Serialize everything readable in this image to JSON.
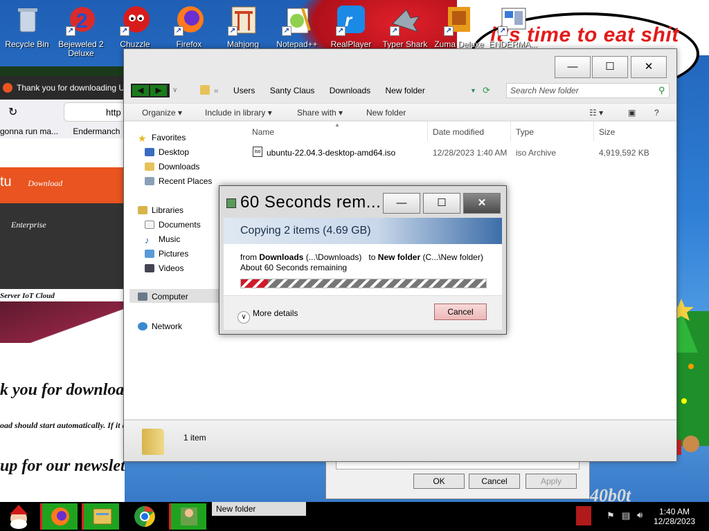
{
  "wallpaper": {
    "speech_text": "it's time to eat shit",
    "bottom_text": "40b0t"
  },
  "desktop_icons": [
    {
      "label": "Recycle Bin",
      "icon": "recycle-bin-icon",
      "shortcut": false
    },
    {
      "label": "Bejeweled 2 Deluxe",
      "icon": "bejeweled-icon",
      "shortcut": true
    },
    {
      "label": "Chuzzle",
      "icon": "chuzzle-icon",
      "shortcut": true
    },
    {
      "label": "Firefox",
      "icon": "firefox-icon",
      "shortcut": true
    },
    {
      "label": "Mahjong",
      "icon": "mahjong-icon",
      "shortcut": true
    },
    {
      "label": "Notepad++",
      "icon": "notepad-plus-icon",
      "shortcut": true
    },
    {
      "label": "RealPlayer",
      "icon": "realplayer-icon",
      "shortcut": true
    },
    {
      "label": "Typer Shark",
      "icon": "typer-shark-icon",
      "shortcut": true
    },
    {
      "label": "Zuma Deluxe",
      "icon": "zuma-icon",
      "shortcut": true
    },
    {
      "label": "ENDERMA...",
      "icon": "enderman-icon",
      "shortcut": true
    }
  ],
  "browser": {
    "tab_title": "Thank you for downloading U",
    "url": "http",
    "bookmark1": "gonna run ma...",
    "bookmark2": "Endermanch",
    "logo_text": "tu",
    "nav_download": "Download",
    "nav_enterprise": "Enterprise",
    "nav_items": "Server    IoT    Cloud",
    "heading1": "k you for downloading",
    "heading2": "oad should start automatically. If it doesn",
    "heading3": "up for our newsletter"
  },
  "properties_dialog": {
    "ok": "OK",
    "cancel": "Cancel",
    "apply": "Apply"
  },
  "explorer": {
    "breadcrumbs": [
      "Users",
      "Santy Claus",
      "Downloads",
      "New folder"
    ],
    "search_placeholder": "Search New folder",
    "toolbar": {
      "organize": "Organize",
      "include": "Include in library",
      "share": "Share with",
      "new_folder": "New folder"
    },
    "nav": {
      "favorites": "Favorites",
      "desktop": "Desktop",
      "downloads": "Downloads",
      "recent": "Recent Places",
      "libraries": "Libraries",
      "documents": "Documents",
      "music": "Music",
      "pictures": "Pictures",
      "videos": "Videos",
      "computer": "Computer",
      "network": "Network"
    },
    "columns": {
      "name": "Name",
      "date": "Date modified",
      "type": "Type",
      "size": "Size"
    },
    "files": [
      {
        "name": "ubuntu-22.04.3-desktop-amd64.iso",
        "date": "12/28/2023 1:40 AM",
        "type": "iso Archive",
        "size": "4,919,592 KB"
      }
    ],
    "status": "1 item"
  },
  "copy_dialog": {
    "title": "60 Seconds rem...",
    "header": "Copying 2 items (4.69 GB)",
    "from_label": "from",
    "from_name": "Downloads",
    "from_path": "(...\\Downloads)",
    "to_label": "to",
    "to_name": "New folder",
    "to_path": "(C...\\New folder)",
    "remaining": "About 60 Seconds remaining",
    "progress": 0.11,
    "more_details": "More details",
    "cancel": "Cancel"
  },
  "taskbar": {
    "window_label": "New folder",
    "time": "1:40 AM",
    "date": "12/28/2023"
  }
}
